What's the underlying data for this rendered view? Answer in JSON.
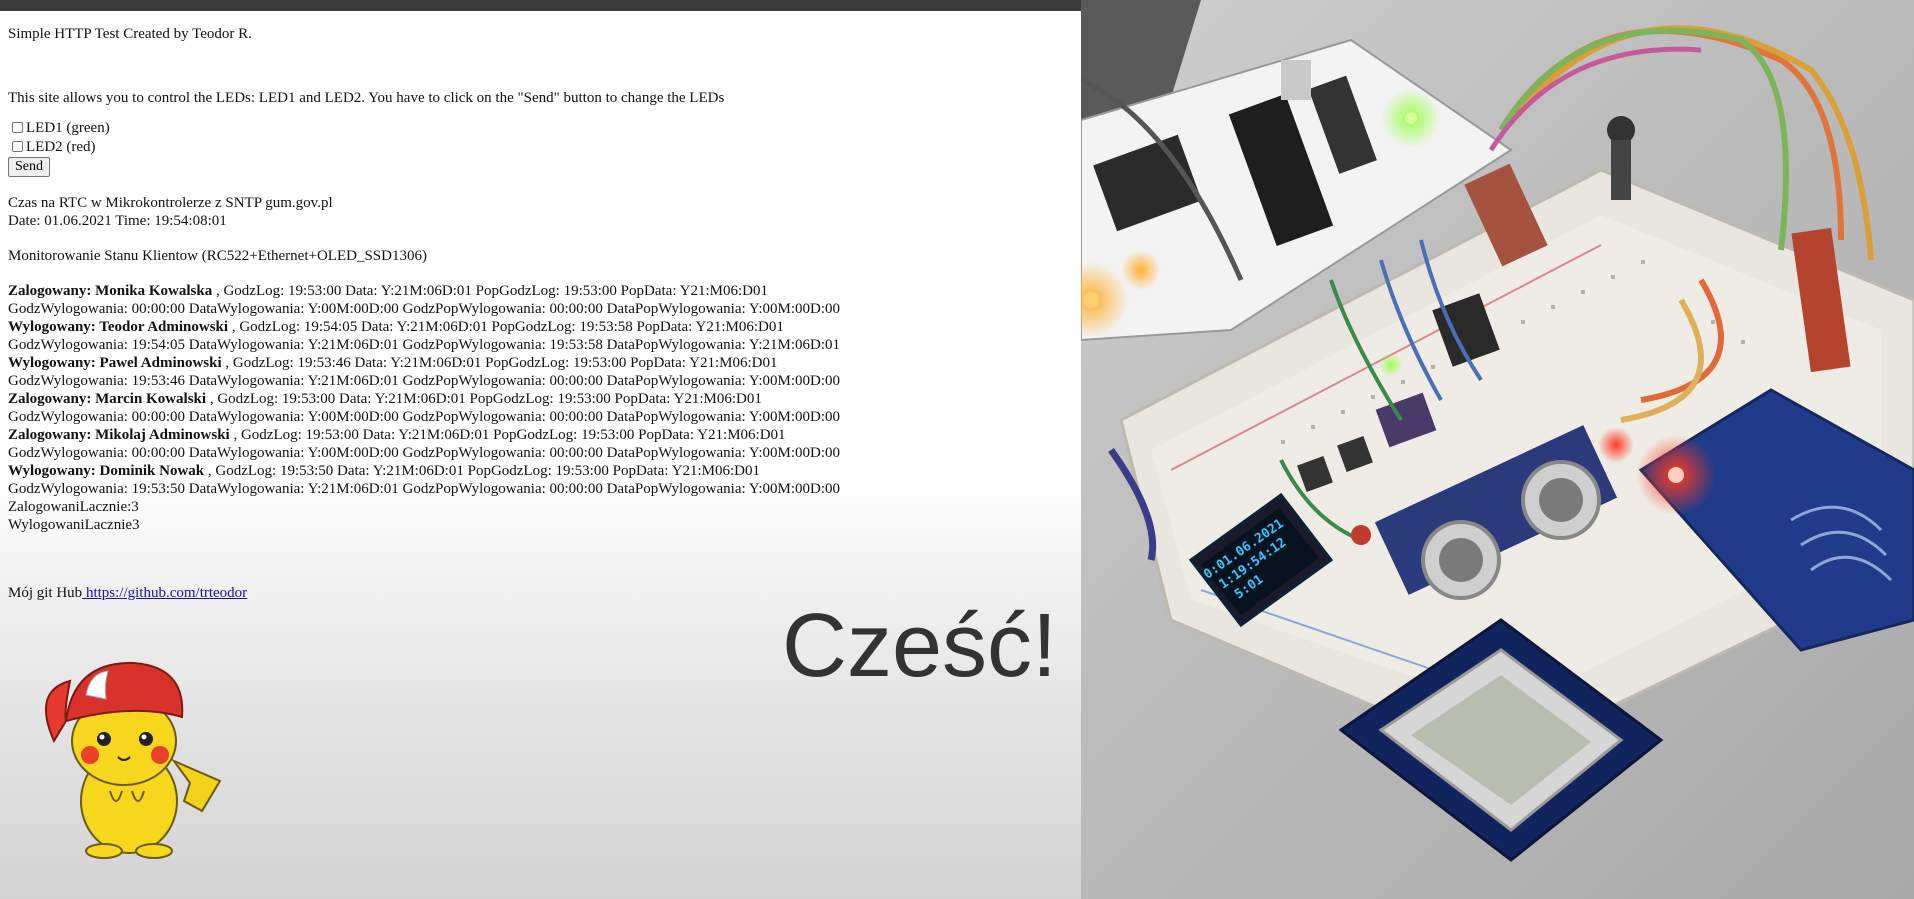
{
  "page": {
    "heading": "Simple HTTP Test Created by Teodor R.",
    "description": "This site allows you to control the LEDs: LED1 and LED2. You have to click on the \"Send\" button to change the LEDs"
  },
  "form": {
    "led1_label": "LED1 (green)",
    "led1_checked": false,
    "led2_label": "LED2 (red)",
    "led2_checked": false,
    "send_label": "Send"
  },
  "rtc": {
    "title": "Czas na RTC w Mikrokontrolerze z SNTP gum.gov.pl",
    "datetime": "Date: 01.06.2021 Time: 19:54:08:01"
  },
  "monitor": {
    "title": "Monitorowanie Stanu Klientow (RC522+Ethernet+OLED_SSD1306)",
    "entries": [
      {
        "status_name": "Zalogowany: Monika Kowalska",
        "line1_rest": " , GodzLog: 19:53:00 Data: Y:21M:06D:01 PopGodzLog: 19:53:00 PopData: Y21:M06:D01",
        "line2": "GodzWylogowania: 00:00:00 DataWylogowania: Y:00M:00D:00 GodzPopWylogowania: 00:00:00 DataPopWylogowania: Y:00M:00D:00"
      },
      {
        "status_name": "Wylogowany: Teodor Adminowski",
        "line1_rest": " , GodzLog: 19:54:05 Data: Y:21M:06D:01 PopGodzLog: 19:53:58 PopData: Y21:M06:D01",
        "line2": "GodzWylogowania: 19:54:05 DataWylogowania: Y:21M:06D:01 GodzPopWylogowania: 19:53:58 DataPopWylogowania: Y:21M:06D:01"
      },
      {
        "status_name": "Wylogowany: Pawel Adminowski",
        "line1_rest": " , GodzLog: 19:53:46 Data: Y:21M:06D:01 PopGodzLog: 19:53:00 PopData: Y21:M06:D01",
        "line2": "GodzWylogowania: 19:53:46 DataWylogowania: Y:21M:06D:01 GodzPopWylogowania: 00:00:00 DataPopWylogowania: Y:00M:00D:00"
      },
      {
        "status_name": "Zalogowany: Marcin Kowalski",
        "line1_rest": " , GodzLog: 19:53:00 Data: Y:21M:06D:01 PopGodzLog: 19:53:00 PopData: Y21:M06:D01",
        "line2": "GodzWylogowania: 00:00:00 DataWylogowania: Y:00M:00D:00 GodzPopWylogowania: 00:00:00 DataPopWylogowania: Y:00M:00D:00"
      },
      {
        "status_name": "Zalogowany: Mikolaj Adminowski",
        "line1_rest": " , GodzLog: 19:53:00 Data: Y:21M:06D:01 PopGodzLog: 19:53:00 PopData: Y21:M06:D01",
        "line2": "GodzWylogowania: 00:00:00 DataWylogowania: Y:00M:00D:00 GodzPopWylogowania: 00:00:00 DataPopWylogowania: Y:00M:00D:00"
      },
      {
        "status_name": "Wylogowany: Dominik Nowak",
        "line1_rest": " , GodzLog: 19:53:50 Data: Y:21M:06D:01 PopGodzLog: 19:53:00 PopData: Y21:M06:D01",
        "line2": "GodzWylogowania: 19:53:50 DataWylogowania: Y:21M:06D:01 GodzPopWylogowania: 00:00:00 DataPopWylogowania: Y:00M:00D:00"
      }
    ],
    "total_logged_in": "ZalogowaniLacznie:3",
    "total_logged_out": "WylogowaniLacznie3"
  },
  "footer": {
    "git_label": "Mój git Hub",
    "git_link": " https://github.com/trteodor"
  },
  "overlay": {
    "greeting": "Cześć!"
  },
  "photo": {
    "oled_line1": "0:01.06.2021",
    "oled_line2": "1:19:54:12",
    "oled_line3": "5:01"
  },
  "colors": {
    "oled_text": "#35c8ff",
    "led_red": "#ff2a1a",
    "led_green": "#7dff3a",
    "led_orange": "#ff9a1a",
    "link": "#1a0dab"
  }
}
